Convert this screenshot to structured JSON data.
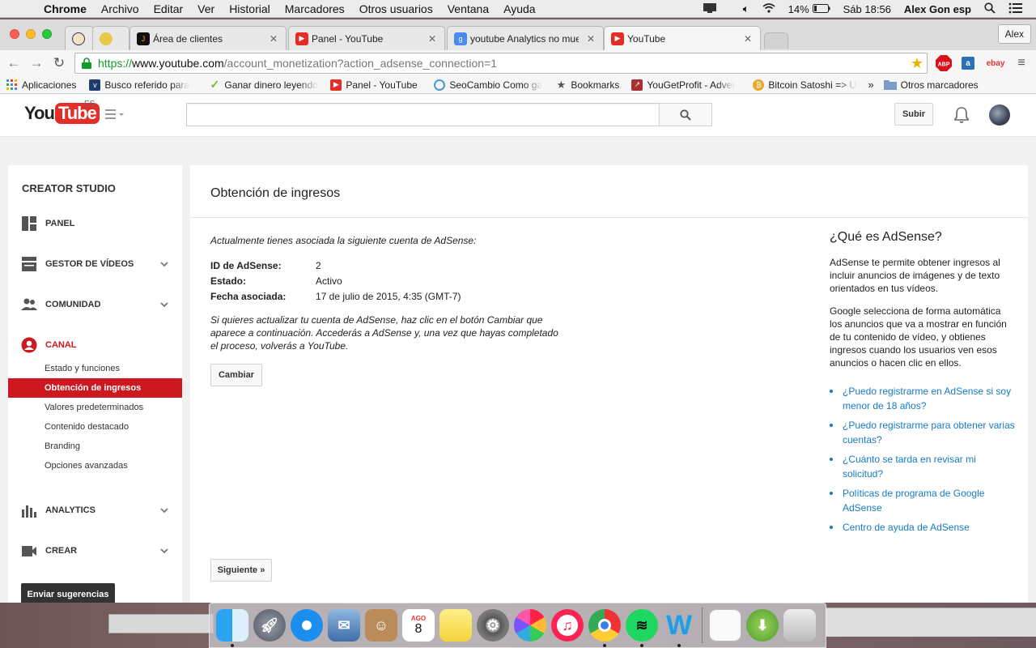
{
  "menubar": {
    "app": "Chrome",
    "items": [
      "Archivo",
      "Editar",
      "Ver",
      "Historial",
      "Marcadores",
      "Otros usuarios",
      "Ventana",
      "Ayuda"
    ],
    "battery": "14%",
    "clock": "Sáb 18:56",
    "user": "Alex Gon esp"
  },
  "browser": {
    "tabs": [
      {
        "label": "",
        "icon": "ninja-favicon"
      },
      {
        "label": "",
        "icon": "bee-favicon"
      },
      {
        "label": "Área de clientes",
        "icon": "j-favicon"
      },
      {
        "label": "Panel - YouTube",
        "icon": "youtube-favicon"
      },
      {
        "label": "youtube Analytics no mues",
        "icon": "analytics-favicon"
      },
      {
        "label": "YouTube",
        "icon": "youtube-favicon"
      }
    ],
    "profile": "Alex",
    "url": {
      "scheme": "https://",
      "host": "www.youtube.com",
      "path": "/account_monetization?action_adsense_connection=1"
    },
    "extensions": [
      "ABP",
      "a",
      "ebay"
    ],
    "bookmarks": [
      {
        "label": "Aplicaciones",
        "icon": "apps-grid-icon"
      },
      {
        "label": "Busco referido para",
        "icon": "bookmark-favicon"
      },
      {
        "label": "Ganar dinero leyendo",
        "icon": "check-favicon"
      },
      {
        "label": "Panel - YouTube",
        "icon": "youtube-favicon"
      },
      {
        "label": "SeoCambio Como ga",
        "icon": "seocambio-favicon"
      },
      {
        "label": "Bookmarks",
        "icon": "star-icon"
      },
      {
        "label": "YouGetProfit - Adver",
        "icon": "chart-favicon"
      },
      {
        "label": "Bitcoin Satoshi => U",
        "icon": "bitcoin-icon"
      }
    ],
    "bookmarks_more": "»",
    "other_bookmarks": "Otros marcadores"
  },
  "youtube": {
    "logo_region": "ES",
    "upload": "Subir"
  },
  "sidebar": {
    "title": "CREATOR STUDIO",
    "sections": [
      {
        "label": "PANEL",
        "icon": "dashboard-icon",
        "expandable": false
      },
      {
        "label": "GESTOR DE VÍDEOS",
        "icon": "video-manager-icon",
        "expandable": true
      },
      {
        "label": "COMUNIDAD",
        "icon": "community-icon",
        "expandable": true
      },
      {
        "label": "CANAL",
        "icon": "channel-icon",
        "expandable": false
      }
    ],
    "channel_items": [
      {
        "label": "Estado y funciones",
        "active": false
      },
      {
        "label": "Obtención de ingresos",
        "active": true
      },
      {
        "label": "Valores predeterminados",
        "active": false
      },
      {
        "label": "Contenido destacado",
        "active": false
      },
      {
        "label": "Branding",
        "active": false
      },
      {
        "label": "Opciones avanzadas",
        "active": false
      }
    ],
    "lower_sections": [
      {
        "label": "ANALYTICS",
        "icon": "analytics-icon"
      },
      {
        "label": "CREAR",
        "icon": "create-icon"
      }
    ],
    "feedback": "Enviar sugerencias"
  },
  "main": {
    "title": "Obtención de ingresos",
    "intro": "Actualmente tienes asociada la siguiente cuenta de AdSense:",
    "fields": [
      {
        "key": "ID de AdSense:",
        "value": "2"
      },
      {
        "key": "Estado:",
        "value": "Activo"
      },
      {
        "key": "Fecha asociada:",
        "value": "17 de julio de 2015, 4:35 (GMT-7)"
      }
    ],
    "explain": "Si quieres actualizar tu cuenta de AdSense, haz clic en el botón Cambiar que aparece a continuación. Accederás a AdSense y, una vez que hayas completado el proceso, volverás a YouTube.",
    "change_button": "Cambiar",
    "next_button": "Siguiente »"
  },
  "aside": {
    "title": "¿Qué es AdSense?",
    "p1": "AdSense te permite obtener ingresos al incluir anuncios de imágenes y de texto orientados en tus vídeos.",
    "p2": "Google selecciona de forma automática los anuncios que va a mostrar en función de tu contenido de vídeo, y obtienes ingresos cuando los usuarios ven esos anuncios o hacen clic en ellos.",
    "links": [
      "¿Puedo registrarme en AdSense si soy menor de 18 años?",
      "¿Puedo registrarme para obtener varias cuentas?",
      "¿Cuánto se tarda en revisar mi solicitud?",
      "Políticas de programa de Google AdSense",
      "Centro de ayuda de AdSense"
    ]
  },
  "dock": {
    "calendar_month": "AGO",
    "calendar_day": "8",
    "apps": [
      "finder-icon",
      "launchpad-icon",
      "safari-icon",
      "mail-icon",
      "contacts-icon",
      "calendar-icon",
      "notes-icon",
      "system-preferences-icon",
      "photos-icon",
      "itunes-icon",
      "chrome-icon",
      "spotify-icon",
      "word-icon"
    ]
  },
  "colors": {
    "youtube_red": "#cc181e",
    "link_blue": "#167ac6",
    "https_green": "#119b2a"
  }
}
